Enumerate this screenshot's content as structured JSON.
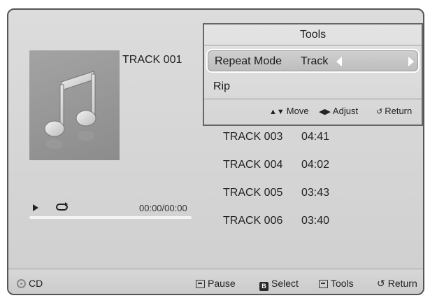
{
  "album": {
    "icon": "music-note-icon",
    "track_title": "TRACK 001"
  },
  "player": {
    "play_icon": "play-icon",
    "repeat_icon": "repeat-icon",
    "time": "00:00/00:00",
    "progress": 0
  },
  "tracks": [
    {
      "name": "TRACK 003",
      "duration": "04:41"
    },
    {
      "name": "TRACK 004",
      "duration": "04:02"
    },
    {
      "name": "TRACK 005",
      "duration": "03:43"
    },
    {
      "name": "TRACK 006",
      "duration": "03:40"
    }
  ],
  "tools_menu": {
    "title": "Tools",
    "repeat_mode": {
      "label": "Repeat Mode",
      "value": "Track"
    },
    "rip": {
      "label": "Rip"
    },
    "hints": {
      "move_glyph": "▲▼",
      "move": "Move",
      "adjust_glyph": "◀▶",
      "adjust": "Adjust",
      "return_glyph": "↺",
      "return": "Return"
    }
  },
  "bottom_bar": {
    "source": "CD",
    "pause": "Pause",
    "select_key": "B",
    "select": "Select",
    "tools": "Tools",
    "return_glyph": "↺",
    "return": "Return"
  }
}
